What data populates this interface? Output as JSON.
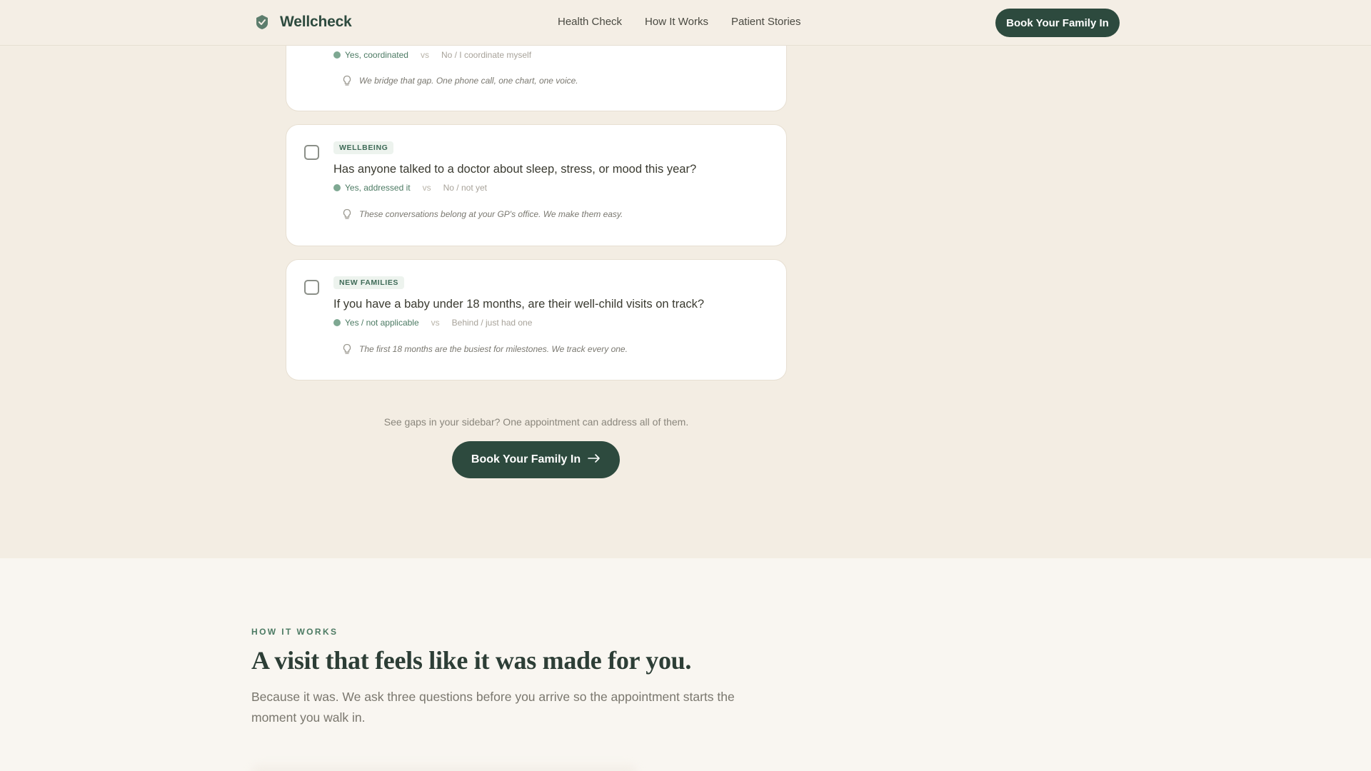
{
  "nav": {
    "brand": "Wellcheck",
    "links": [
      "Health Check",
      "How It Works",
      "Patient Stories"
    ],
    "cta": "Book Your Family In"
  },
  "cards": [
    {
      "question": "",
      "answer_yes": "Yes, coordinated",
      "vs": "vs",
      "answer_no": "No / I coordinate myself",
      "tip": "We bridge that gap. One phone call, one chart, one voice."
    },
    {
      "tag": "WELLBEING",
      "question": "Has anyone talked to a doctor about sleep, stress, or mood this year?",
      "answer_yes": "Yes, addressed it",
      "vs": "vs",
      "answer_no": "No / not yet",
      "tip": "These conversations belong at your GP's office. We make them easy."
    },
    {
      "tag": "NEW FAMILIES",
      "question": "If you have a baby under 18 months, are their well-child visits on track?",
      "answer_yes": "Yes / not applicable",
      "vs": "vs",
      "answer_no": "Behind / just had one",
      "tip": "The first 18 months are the busiest for milestones. We track every one."
    }
  ],
  "cta": {
    "note": "See gaps in your sidebar? One appointment can address all of them.",
    "button": "Book Your Family In"
  },
  "how_it_works": {
    "eyebrow": "HOW IT WORKS",
    "heading": "A visit that feels like it was made for you.",
    "lede": "Because it was. We ask three questions before you arrive so the appointment starts the moment you walk in."
  },
  "colors": {
    "brand_green": "#2d4a3e",
    "accent_green": "#4c7a63",
    "background": "#f3ede3"
  }
}
